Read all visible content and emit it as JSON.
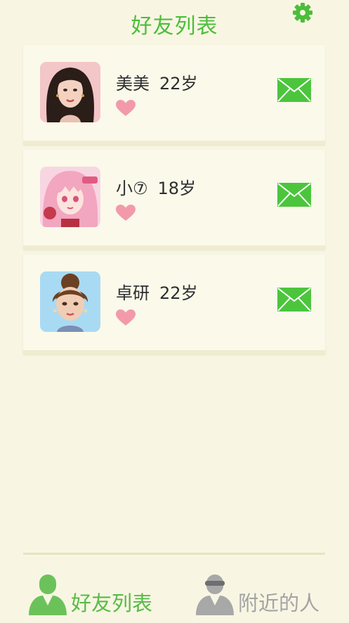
{
  "header": {
    "title": "好友列表",
    "settings_icon": "gear-icon"
  },
  "colors": {
    "accent": "#4cbe3a",
    "background": "#f8f6e3",
    "heart": "#f29aaa",
    "mail": "#4cc53d",
    "inactive": "#a3a3a3"
  },
  "friends": [
    {
      "name": "美美",
      "age": "22岁",
      "heart_icon": "heart-icon",
      "message_icon": "envelope-icon"
    },
    {
      "name": "小⑦",
      "age": "18岁",
      "heart_icon": "heart-icon",
      "message_icon": "envelope-icon"
    },
    {
      "name": "卓研",
      "age": "22岁",
      "heart_icon": "heart-icon",
      "message_icon": "envelope-icon"
    }
  ],
  "tabbar": {
    "friends_label": "好友列表",
    "nearby_label": "附近的人",
    "friends_icon": "person-icon",
    "nearby_icon": "masked-person-icon"
  }
}
